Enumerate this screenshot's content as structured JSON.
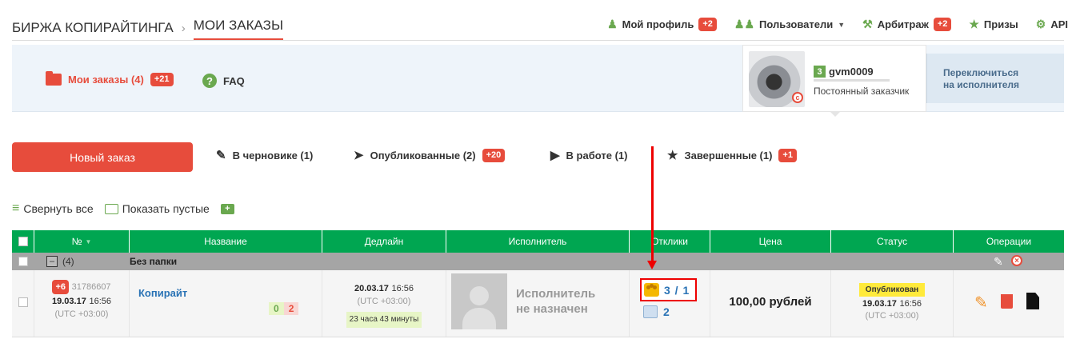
{
  "breadcrumb": {
    "root": "БИРЖА КОПИРАЙТИНГА",
    "separator": "›",
    "current": "МОИ ЗАКАЗЫ"
  },
  "topnav": {
    "profile": {
      "label": "Мой профиль",
      "badge": "+2"
    },
    "users": {
      "label": "Пользователи"
    },
    "arbitrage": {
      "label": "Арбитраж",
      "badge": "+2"
    },
    "prizes": {
      "label": "Призы"
    },
    "api": {
      "label": "API"
    }
  },
  "band": {
    "my_orders": {
      "label": "Мои заказы (4)",
      "badge": "+21"
    },
    "faq": {
      "label": "FAQ"
    }
  },
  "profile_card": {
    "level": "3",
    "username": "gvm0009",
    "role": "Постоянный заказчик",
    "switch_text_1": "Переключиться",
    "switch_text_2": "на исполнителя"
  },
  "actions": {
    "new_order": "Новый заказ",
    "filters": [
      {
        "label": "В черновике (1)",
        "badge": ""
      },
      {
        "label": "Опубликованные (2)",
        "badge": "+20"
      },
      {
        "label": "В работе (1)",
        "badge": ""
      },
      {
        "label": "Завершенные (1)",
        "badge": "+1"
      }
    ]
  },
  "tools": {
    "collapse_all": "Свернуть все",
    "show_empty": "Показать пустые",
    "add_folder": "+"
  },
  "table": {
    "headers": [
      "№",
      "Название",
      "Дедлайн",
      "Исполнитель",
      "Отклики",
      "Цена",
      "Статус",
      "Операции"
    ],
    "folder": {
      "count": "(4)",
      "name": "Без папки"
    },
    "rows": [
      {
        "badge": "+6",
        "id": "31786607",
        "date": "19.03.17",
        "time": "16:56",
        "tz": "(UTC +03:00)",
        "title": "Копирайт",
        "count_green": "0",
        "count_red": "2",
        "deadline_date": "20.03.17",
        "deadline_time": "16:56",
        "deadline_tz": "(UTC +03:00)",
        "deadline_left": "23 часа 43 минуты",
        "executor_line1": "Исполнитель",
        "executor_line2": "не назначен",
        "responses": "3 / 1",
        "responses_edit": "2",
        "price": "100,00 рублей",
        "status": "Опубликован",
        "status_date": "19.03.17",
        "status_time": "16:56",
        "status_tz": "(UTC +03:00)"
      }
    ]
  },
  "colors": {
    "accent_red": "#e74c3c",
    "header_green": "#00a651",
    "icon_green": "#6aa84f",
    "link_blue": "#2a73b5"
  }
}
